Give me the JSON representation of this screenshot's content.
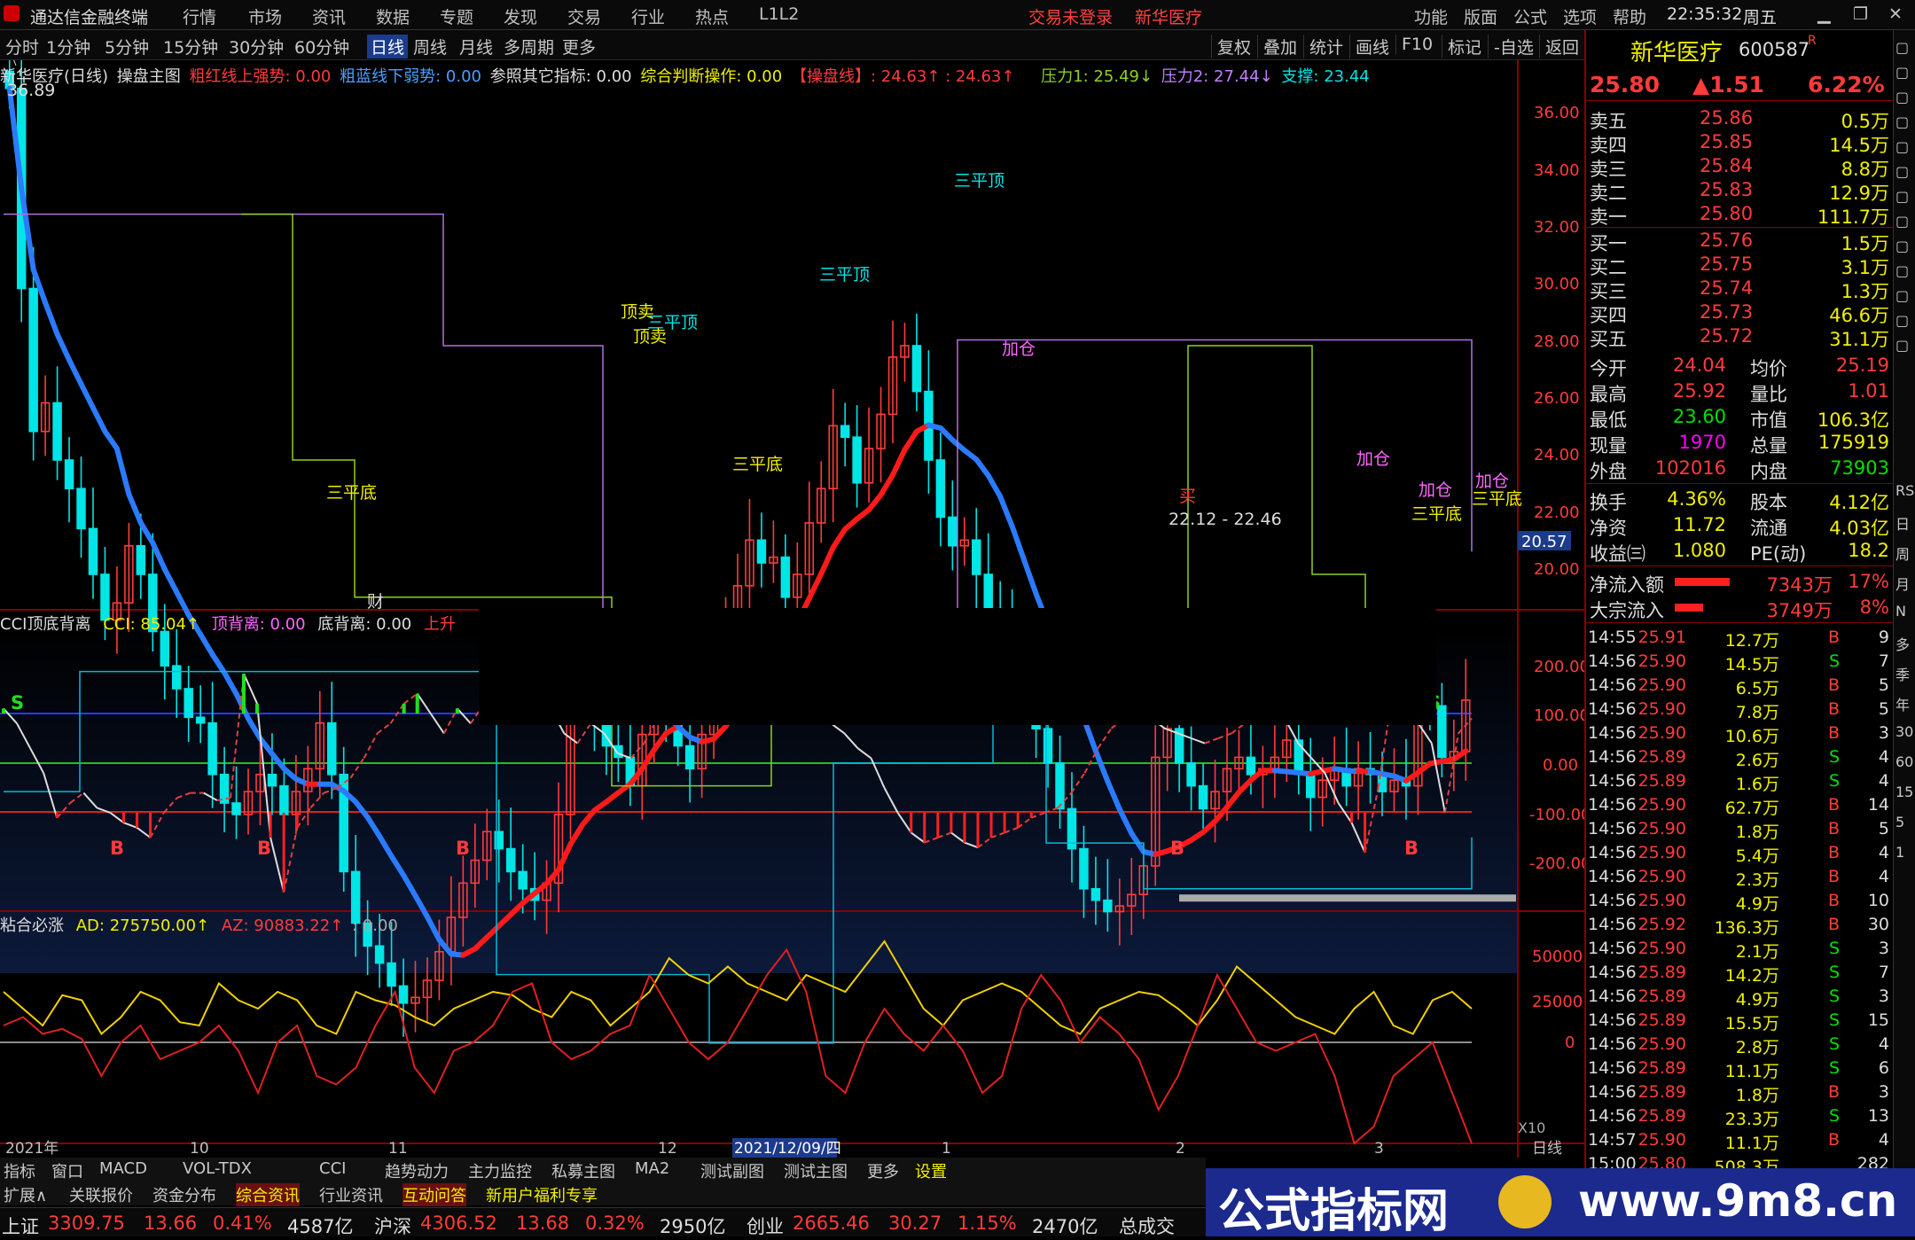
{
  "menu": {
    "app_title": "通达信金融终端",
    "items": [
      "行情",
      "市场",
      "资讯",
      "数据",
      "专题",
      "发现",
      "交易",
      "行业",
      "热点",
      "L1L2"
    ],
    "login": "交易未登录",
    "stock_link": "新华医疗",
    "right_items": [
      "功能",
      "版面",
      "公式",
      "选项",
      "帮助"
    ],
    "time": "22:35:32",
    "weekday": "周五"
  },
  "timeframes": [
    "分时",
    "1分钟",
    "5分钟",
    "15分钟",
    "30分钟",
    "60分钟",
    "日线",
    "周线",
    "月线",
    "多周期",
    "更多"
  ],
  "tools": [
    "复权",
    "叠加",
    "统计",
    "画线",
    "F10",
    "标记",
    "-自选",
    "返回"
  ],
  "main_ind": {
    "name": "新华医疗(日线)",
    "formula": "操盘主图",
    "t1": "粗红线上强势: 0.00",
    "t2": "粗蓝线下弱势: 0.00",
    "t3": "参照其它指标: 0.00",
    "t4": "综合判断操作: 0.00",
    "t5": "【操盘线】: 24.63↑ : 24.63↑",
    "p1": "压力1: 25.49↓",
    "p2": "压力2: 27.44↓",
    "sup": "支撑: 23.44"
  },
  "yaxis_main": [
    "36.00",
    "34.00",
    "32.00",
    "30.00",
    "28.00",
    "26.00",
    "24.00",
    "22.00",
    "20.00"
  ],
  "price_tag": "20.57",
  "chart_labels": {
    "high": "36.89",
    "range": "22.12 - 22.46",
    "cai": "财",
    "sanpingdi": "三平底",
    "sanpingding": "三平顶",
    "dingmai": "顶卖",
    "jiacang": "加仓",
    "mai": "买"
  },
  "cci": {
    "name": "CCI顶底背离",
    "cci": "CCI: 85.04↑",
    "dbl": "顶背离: 0.00",
    "dibl": "底背离: 0.00",
    "up": "上升",
    "yaxis": [
      "200.00",
      "100.00",
      "0.00",
      "-100.00",
      "-200.00"
    ],
    "s": "S",
    "b": "B"
  },
  "ad": {
    "name": "粘合必涨",
    "ad": "AD: 275750.00↑",
    "az": "AZ: 90883.22↑",
    "v": ": 0.00",
    "yaxis": [
      "50000",
      "25000",
      "0"
    ],
    "x10": "X10"
  },
  "xaxis": {
    "l1": "2021年",
    "l2": "10",
    "l3": "11",
    "l4": "12",
    "l5": "2021/12/09/四",
    "l6": "1",
    "l7": "2",
    "l8": "3",
    "cycle": "日线"
  },
  "stock": {
    "name": "新华医疗",
    "code": "600587",
    "flag": "R",
    "price": "25.80",
    "chg": "▲1.51",
    "pct": "6.22%"
  },
  "asks": [
    {
      "l": "卖五",
      "p": "25.86",
      "v": "0.5万"
    },
    {
      "l": "卖四",
      "p": "25.85",
      "v": "14.5万"
    },
    {
      "l": "卖三",
      "p": "25.84",
      "v": "8.8万"
    },
    {
      "l": "卖二",
      "p": "25.83",
      "v": "12.9万"
    },
    {
      "l": "卖一",
      "p": "25.80",
      "v": "111.7万"
    }
  ],
  "bids": [
    {
      "l": "买一",
      "p": "25.76",
      "v": "1.5万"
    },
    {
      "l": "买二",
      "p": "25.75",
      "v": "3.1万"
    },
    {
      "l": "买三",
      "p": "25.74",
      "v": "1.3万"
    },
    {
      "l": "买四",
      "p": "25.73",
      "v": "46.6万"
    },
    {
      "l": "买五",
      "p": "25.72",
      "v": "31.1万"
    }
  ],
  "stats": [
    [
      "今开",
      "24.04",
      "均价",
      "25.19"
    ],
    [
      "最高",
      "25.92",
      "量比",
      "1.01"
    ],
    [
      "最低",
      "23.60",
      "市值",
      "106.3亿"
    ],
    [
      "现量",
      "1970",
      "总量",
      "175919"
    ],
    [
      "外盘",
      "102016",
      "内盘",
      "73903"
    ]
  ],
  "stats2": [
    [
      "换手",
      "4.36%",
      "股本",
      "4.12亿"
    ],
    [
      "净资",
      "11.72",
      "流通",
      "4.03亿"
    ],
    [
      "收益㈢",
      "1.080",
      "PE(动)",
      "18.2"
    ]
  ],
  "flows": [
    [
      "净流入额",
      "7343万",
      "17%"
    ],
    [
      "大宗流入",
      "3749万",
      "8%"
    ]
  ],
  "trades": [
    [
      "14:55",
      "25.91",
      "12.7万",
      "B",
      "9"
    ],
    [
      "14:56",
      "25.90",
      "14.5万",
      "S",
      "7"
    ],
    [
      "14:56",
      "25.90",
      "6.5万",
      "B",
      "5"
    ],
    [
      "14:56",
      "25.90",
      "7.8万",
      "B",
      "5"
    ],
    [
      "14:56",
      "25.90",
      "10.6万",
      "B",
      "3"
    ],
    [
      "14:56",
      "25.89",
      "2.6万",
      "S",
      "4"
    ],
    [
      "14:56",
      "25.89",
      "1.6万",
      "S",
      "4"
    ],
    [
      "14:56",
      "25.90",
      "62.7万",
      "B",
      "14"
    ],
    [
      "14:56",
      "25.90",
      "1.8万",
      "B",
      "5"
    ],
    [
      "14:56",
      "25.90",
      "5.4万",
      "B",
      "4"
    ],
    [
      "14:56",
      "25.90",
      "2.3万",
      "B",
      "4"
    ],
    [
      "14:56",
      "25.90",
      "4.9万",
      "B",
      "10"
    ],
    [
      "14:56",
      "25.92",
      "136.3万",
      "B",
      "30"
    ],
    [
      "14:56",
      "25.90",
      "2.1万",
      "S",
      "3"
    ],
    [
      "14:56",
      "25.89",
      "14.2万",
      "S",
      "7"
    ],
    [
      "14:56",
      "25.89",
      "4.9万",
      "S",
      "3"
    ],
    [
      "14:56",
      "25.89",
      "15.5万",
      "S",
      "15"
    ],
    [
      "14:56",
      "25.90",
      "2.8万",
      "S",
      "4"
    ],
    [
      "14:56",
      "25.89",
      "11.1万",
      "S",
      "6"
    ],
    [
      "14:56",
      "25.89",
      "1.8万",
      "B",
      "3"
    ],
    [
      "14:56",
      "25.89",
      "23.3万",
      "S",
      "13"
    ],
    [
      "14:57",
      "25.90",
      "11.1万",
      "B",
      "4"
    ],
    [
      "15:00",
      "25.80",
      "508.3万",
      "",
      "282"
    ]
  ],
  "sidebar": [
    "RSI",
    "日",
    "周",
    "月",
    "N",
    "多",
    "季",
    "年",
    "30",
    "60",
    "15",
    "5",
    "1"
  ],
  "tabs1": [
    "指标",
    "窗口",
    "MACD",
    "VOL-TDX",
    "CCI",
    "趋势动力",
    "主力监控",
    "私募主图",
    "MA2",
    "测试副图",
    "测试主图",
    "更多",
    "设置"
  ],
  "tabs2": [
    "扩展∧",
    "关联报价",
    "资金分布",
    "综合资讯",
    "行业资讯",
    "互动问答",
    "新用户福利专享"
  ],
  "status": [
    {
      "n": "上证",
      "p": "3309.75",
      "c": "13.66",
      "pc": "0.41%",
      "v": "4587亿"
    },
    {
      "n": "沪深",
      "p": "4306.52",
      "c": "13.68",
      "pc": "0.32%",
      "v": "2950亿"
    },
    {
      "n": "创业",
      "p": "2665.46",
      "c": "30.27",
      "pc": "1.15%",
      "v": "2470亿"
    }
  ],
  "status_last": "总成交",
  "banner": {
    "t1": "公式指标网",
    "t2": "www.9m8.cn"
  },
  "colors": {
    "up": "#ff3b3b",
    "down": "#00e5e5",
    "yellow": "#f0f000",
    "green": "#00e000",
    "magenta": "#ff00ff"
  }
}
